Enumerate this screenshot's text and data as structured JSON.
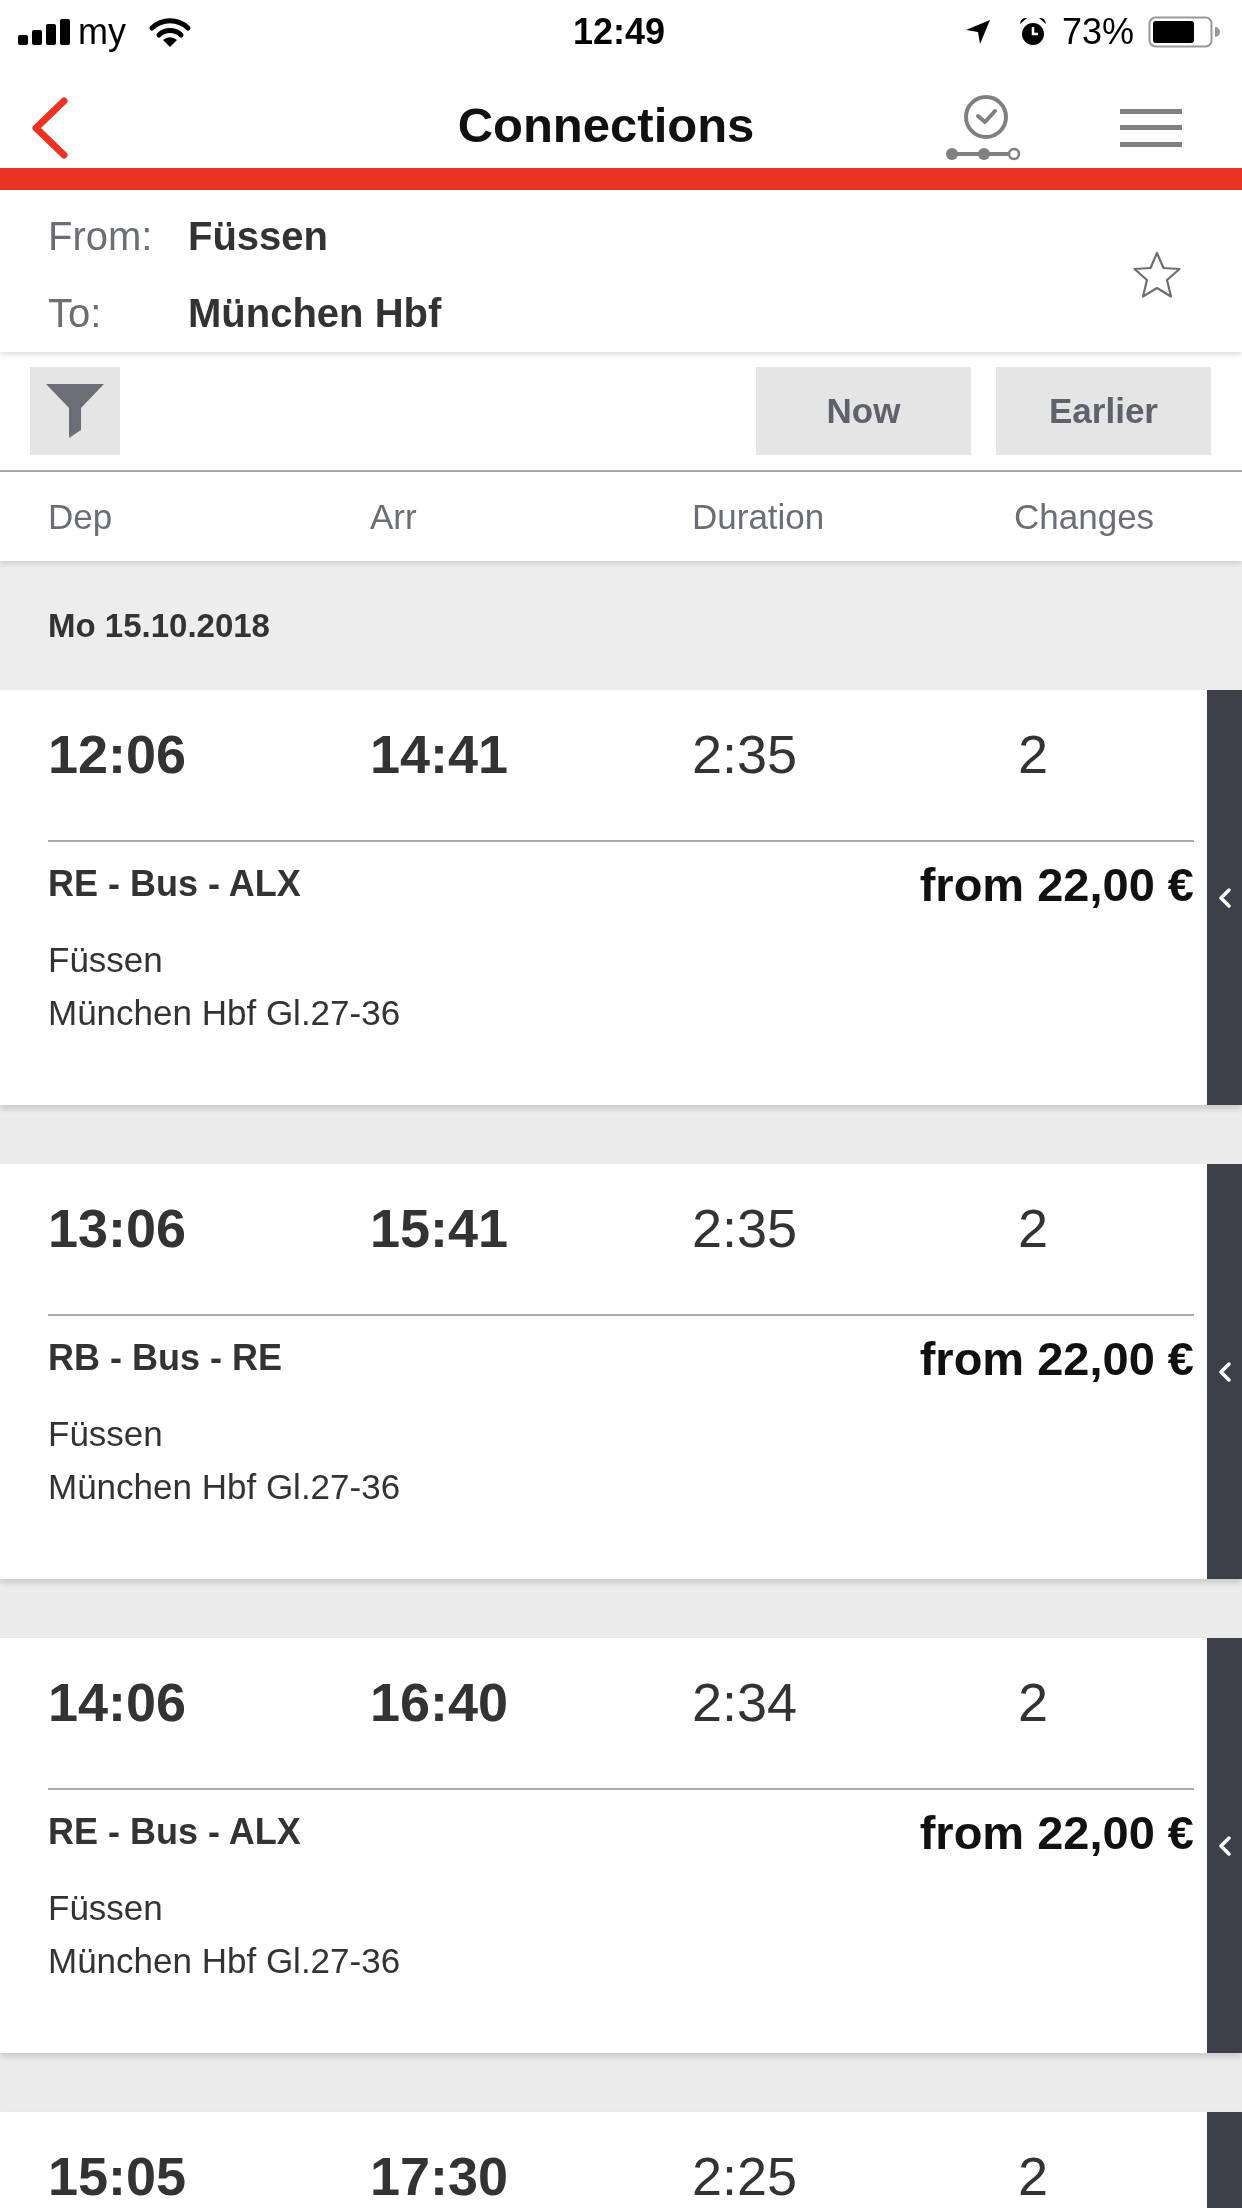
{
  "status_bar": {
    "carrier": "my",
    "time": "12:49",
    "battery": "73%"
  },
  "header": {
    "title": "Connections"
  },
  "route": {
    "from_label": "From:",
    "from": "Füssen",
    "to_label": "To:",
    "to": "München Hbf",
    "favorite": false
  },
  "toolbar": {
    "buttons": [
      "Now",
      "Earlier"
    ]
  },
  "columns": [
    "Dep",
    "Arr",
    "Duration",
    "Changes"
  ],
  "date": "Mo 15.10.2018",
  "connections": [
    {
      "dep": "12:06",
      "arr": "14:41",
      "duration": "2:35",
      "changes": "2",
      "products": "RE - Bus - ALX",
      "price": "from 22,00 €",
      "origin": "Füssen",
      "destination": "München Hbf Gl.27-36"
    },
    {
      "dep": "13:06",
      "arr": "15:41",
      "duration": "2:35",
      "changes": "2",
      "products": "RB - Bus - RE",
      "price": "from 22,00 €",
      "origin": "Füssen",
      "destination": "München Hbf Gl.27-36"
    },
    {
      "dep": "14:06",
      "arr": "16:40",
      "duration": "2:34",
      "changes": "2",
      "products": "RE - Bus - ALX",
      "price": "from 22,00 €",
      "origin": "Füssen",
      "destination": "München Hbf Gl.27-36"
    },
    {
      "dep": "15:05",
      "arr": "17:30",
      "duration": "2:25",
      "changes": "2"
    }
  ]
}
